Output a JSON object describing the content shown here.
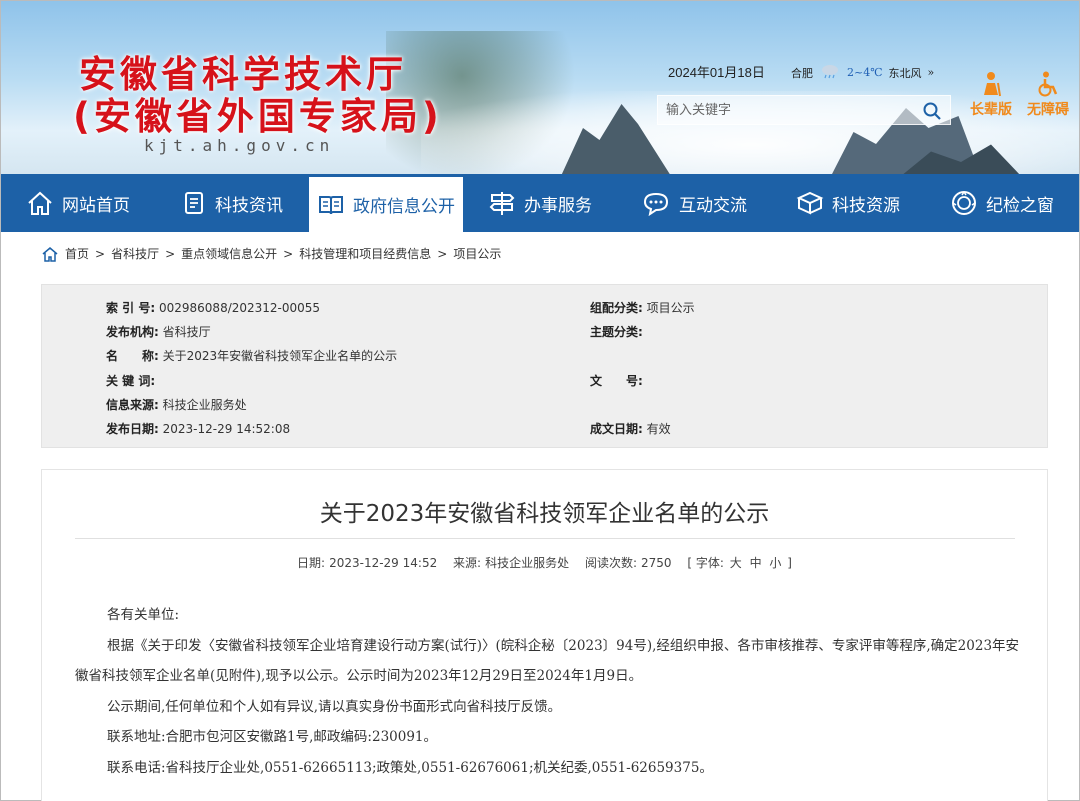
{
  "header": {
    "title_line1": "安徽省科学技术厅",
    "title_line2": "(安徽省外国专家局)",
    "domain": "kjt.ah.gov.cn",
    "date": "2024年01月18日",
    "weather": {
      "city": "合肥",
      "temp": "2~4℃",
      "wind": "东北风",
      "more": "»"
    },
    "search_placeholder": "输入关键字",
    "elder_label": "长辈版",
    "accessible_label": "无障碍",
    "accent_color": "#d6121a"
  },
  "nav": {
    "items": [
      {
        "label": "网站首页",
        "icon": "home-icon"
      },
      {
        "label": "科技资讯",
        "icon": "document-icon"
      },
      {
        "label": "政府信息公开",
        "icon": "book-icon"
      },
      {
        "label": "办事服务",
        "icon": "signpost-icon"
      },
      {
        "label": "互动交流",
        "icon": "chat-icon"
      },
      {
        "label": "科技资源",
        "icon": "cube-icon"
      },
      {
        "label": "纪检之窗",
        "icon": "badge-icon"
      }
    ],
    "active_index": 2,
    "color": "#1d61a7"
  },
  "breadcrumb": [
    "首页",
    "省科技厅",
    "重点领域信息公开",
    "科技管理和项目经费信息",
    "项目公示"
  ],
  "meta": {
    "index_label": "索 引 号:",
    "index_value": "002986088/202312-00055",
    "org_label": "发布机构:",
    "org_value": "省科技厅",
    "name_label": "名　　称:",
    "name_value": "关于2023年安徽省科技领军企业名单的公示",
    "keywords_label": "关 键 词:",
    "keywords_value": "",
    "source_label": "信息来源:",
    "source_value": "科技企业服务处",
    "pubdate_label": "发布日期:",
    "pubdate_value": "2023-12-29 14:52:08",
    "group_label": "组配分类:",
    "group_value": "项目公示",
    "topic_label": "主题分类:",
    "topic_value": "",
    "docno_label": "文　　号:",
    "docno_value": "",
    "validity_label": "成文日期:",
    "validity_value": "有效"
  },
  "article": {
    "title": "关于2023年安徽省科技领军企业名单的公示",
    "date_label": "日期:",
    "date_value": "2023-12-29 14:52",
    "source_label": "来源:",
    "source_value": "科技企业服务处",
    "views_label": "阅读次数:",
    "views_value": "2750",
    "font_label_open": "[ 字体:",
    "font_large": "大",
    "font_medium": "中",
    "font_small": "小",
    "font_label_close": "]",
    "salutation": "各有关单位:",
    "paragraphs": [
      "根据《关于印发〈安徽省科技领军企业培育建设行动方案(试行)〉(皖科企秘〔2023〕94号),经组织申报、各市审核推荐、专家评审等程序,确定2023年安徽省科技领军企业名单(见附件),现予以公示。公示时间为2023年12月29日至2024年1月9日。",
      "公示期间,任何单位和个人如有异议,请以真实身份书面形式向省科技厅反馈。",
      "联系地址:合肥市包河区安徽路1号,邮政编码:230091。",
      "联系电话:省科技厅企业处,0551-62665113;政策处,0551-62676061;机关纪委,0551-62659375。"
    ]
  }
}
